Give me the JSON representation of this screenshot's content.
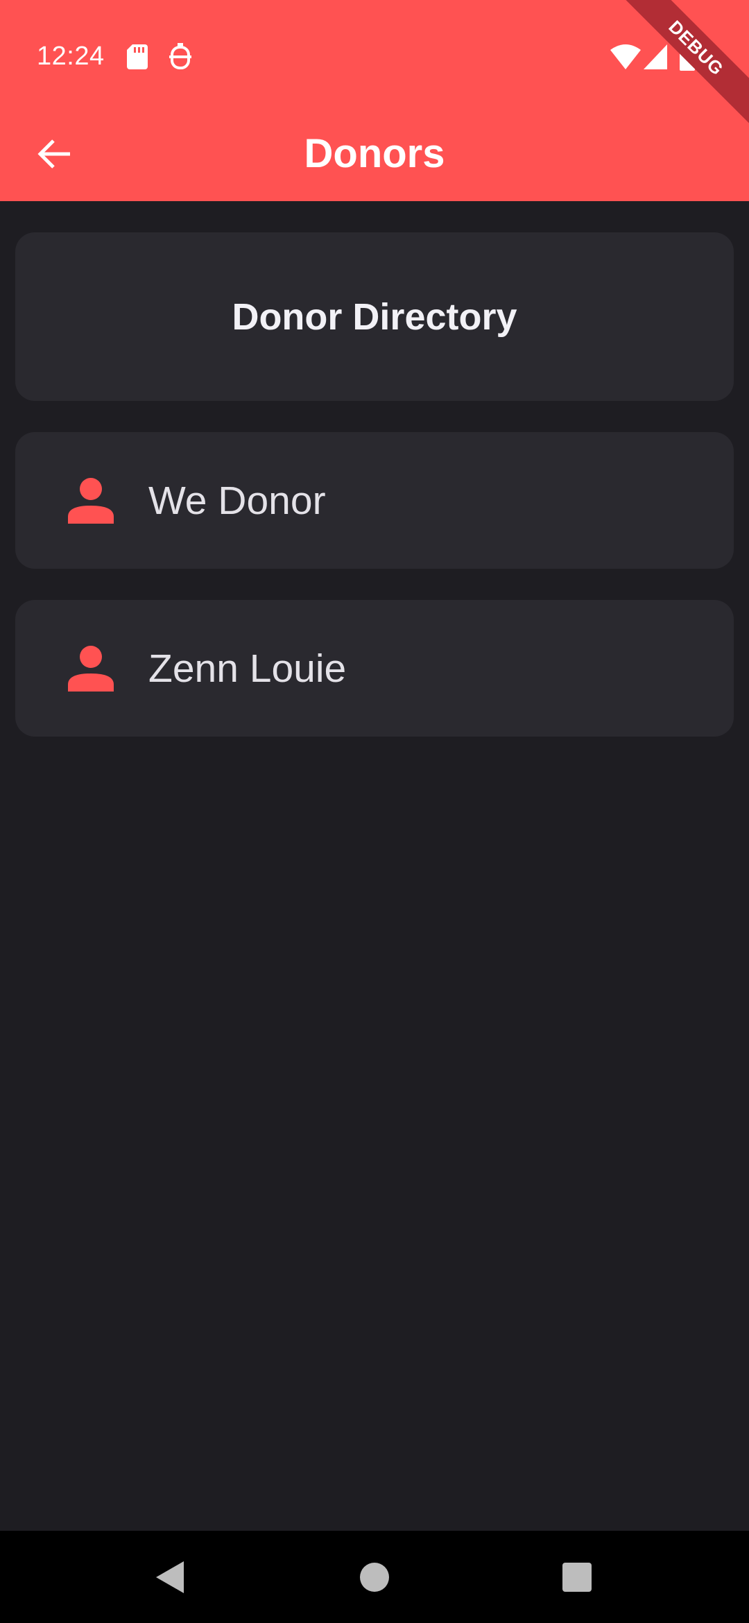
{
  "status_bar": {
    "time": "12:24",
    "icons": [
      "sd-card-icon",
      "notification-badge-icon",
      "wifi-icon",
      "cellular-signal-icon",
      "battery-icon"
    ]
  },
  "app_bar": {
    "title": "Donors",
    "back_icon": "arrow-back-icon"
  },
  "debug_banner": "DEBUG",
  "header_card": {
    "title": "Donor Directory"
  },
  "donors": [
    {
      "name": "We Donor",
      "icon": "person-icon"
    },
    {
      "name": "Zenn Louie",
      "icon": "person-icon"
    }
  ],
  "nav_bar": {
    "buttons": [
      "back-triangle-icon",
      "home-circle-icon",
      "recents-square-icon"
    ]
  },
  "colors": {
    "accent": "#ff5252",
    "background": "#1e1d22",
    "card": "#2a292f",
    "debug_banner": "#b22d35"
  }
}
